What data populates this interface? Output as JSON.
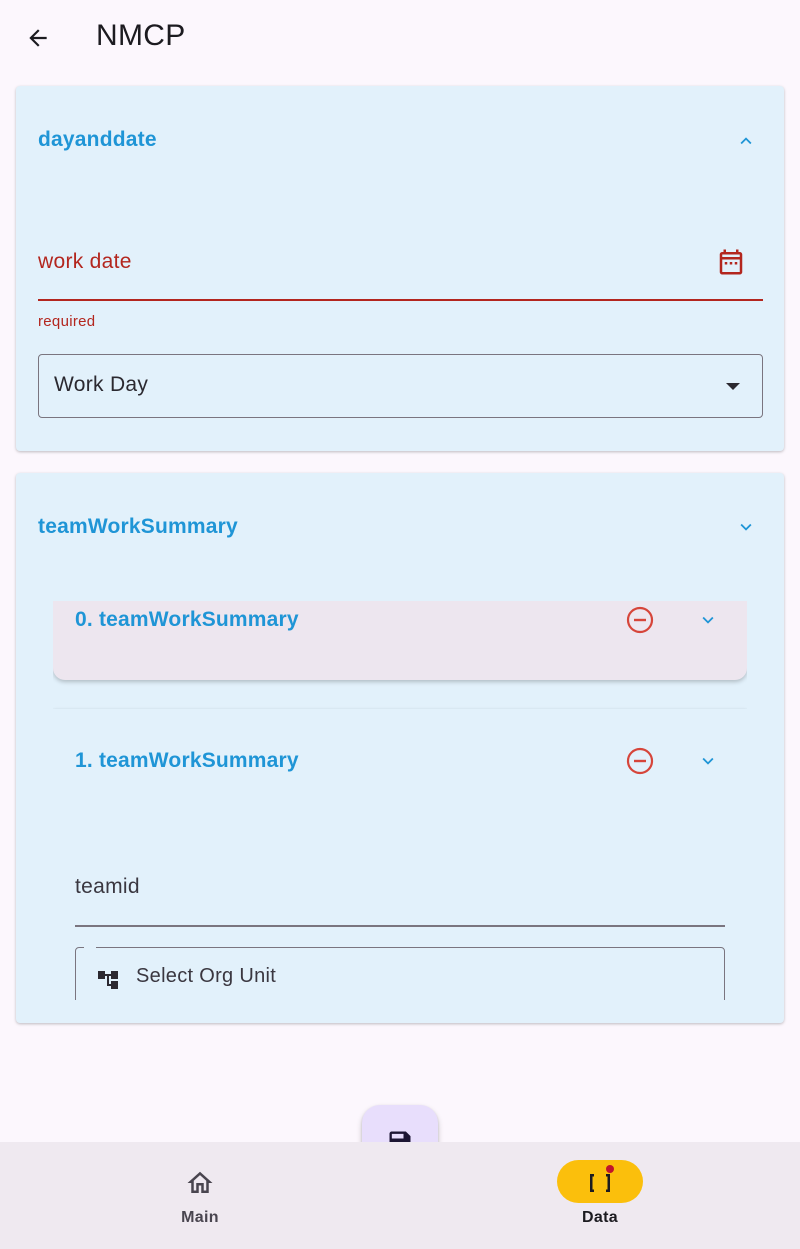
{
  "app": {
    "title": "NMCP"
  },
  "colors": {
    "accent": "#1f95d6",
    "error": "#b3261e",
    "nav_active": "#fbbf0c",
    "card_bg": "#e2f1fb"
  },
  "section_dayanddate": {
    "title": "dayanddate",
    "expanded": true,
    "work_date": {
      "label": "work date",
      "error_text": "required",
      "icon": "calendar-icon"
    },
    "day_type": {
      "value": "Work Day"
    }
  },
  "section_team": {
    "title": "teamWorkSummary",
    "items": [
      {
        "title": "0. teamWorkSummary"
      },
      {
        "title": "1. teamWorkSummary",
        "teamid_label": "teamid",
        "org_unit_placeholder": "Select Org Unit"
      }
    ]
  },
  "fab": {
    "icon": "save-icon"
  },
  "bottom_nav": {
    "items": [
      {
        "label": "Main",
        "icon": "home-icon",
        "active": false
      },
      {
        "label": "Data",
        "icon": "brackets-icon",
        "active": true,
        "badge": true
      }
    ]
  }
}
